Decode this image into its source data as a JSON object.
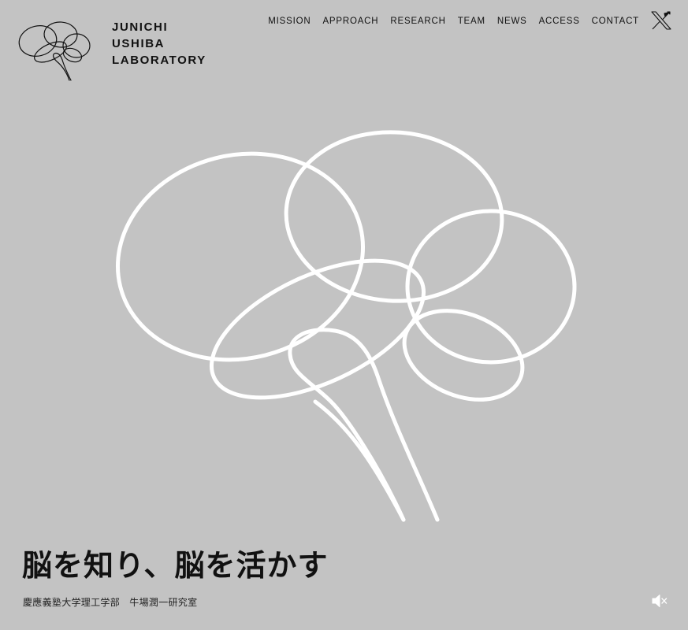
{
  "header": {
    "logo_lines": [
      "JUNICHI",
      "USHIBA",
      "LABORATORY"
    ],
    "logo_icon": "brain-outline-icon"
  },
  "nav": {
    "items": [
      {
        "label": "MISSION"
      },
      {
        "label": "APPROACH"
      },
      {
        "label": "RESEARCH"
      },
      {
        "label": "TEAM"
      },
      {
        "label": "NEWS"
      },
      {
        "label": "ACCESS"
      },
      {
        "label": "CONTACT"
      }
    ],
    "social_icon": "x-twitter-icon"
  },
  "hero": {
    "graphic_icon": "brain-line-drawing-icon",
    "headline": "脳を知り、脳を活かす",
    "subline": "慶應義塾大学理工学部　牛場潤一研究室"
  },
  "controls": {
    "sound_icon": "speaker-muted-icon"
  },
  "colors": {
    "background": "#c3c3c3",
    "text": "#111111",
    "graphic_stroke": "#ffffff"
  }
}
